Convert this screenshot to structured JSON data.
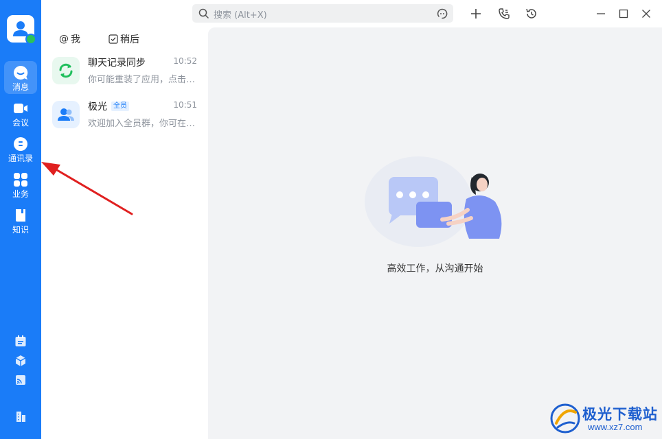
{
  "rail": {
    "items": [
      {
        "label": "消息",
        "icon": "message-icon",
        "active": true
      },
      {
        "label": "会议",
        "icon": "video-meeting-icon"
      },
      {
        "label": "通讯录",
        "icon": "contacts-icon"
      },
      {
        "label": "业务",
        "icon": "apps-grid-icon"
      },
      {
        "label": "知识",
        "icon": "knowledge-book-icon"
      }
    ],
    "tools": [
      "calendar-icon",
      "cube-icon",
      "cast-icon",
      "building-icon"
    ]
  },
  "chatlist": {
    "filters": [
      {
        "label": "我",
        "icon": "at-icon"
      },
      {
        "label": "稍后",
        "icon": "checkbox-icon"
      }
    ],
    "conversations": [
      {
        "title": "聊天记录同步",
        "time": "10:52",
        "preview": "你可能重装了应用，点击…",
        "icon": "sync-icon",
        "icon_bg": "#e8f8ef",
        "icon_color": "#1fbf5c"
      },
      {
        "title": "极光",
        "tag": "全员",
        "time": "10:51",
        "preview": "欢迎加入全员群，你可在…",
        "icon": "group-users-icon",
        "icon_bg": "#e6f1ff",
        "icon_color": "#1a7cf8"
      }
    ]
  },
  "topbar": {
    "search_placeholder": "搜索 (Alt+X)",
    "icons": [
      "search-icon",
      "assistant-icon",
      "add-icon",
      "call-icon",
      "history-icon",
      "minimize-icon",
      "maximize-icon",
      "close-icon"
    ]
  },
  "main": {
    "empty_text": "高效工作，从沟通开始"
  },
  "watermark": {
    "title": "极光下载站",
    "url": "www.xz7.com"
  },
  "colors": {
    "rail": "#1a7cf8",
    "main_bg": "#f2f3f5",
    "arrow": "#e02020"
  }
}
